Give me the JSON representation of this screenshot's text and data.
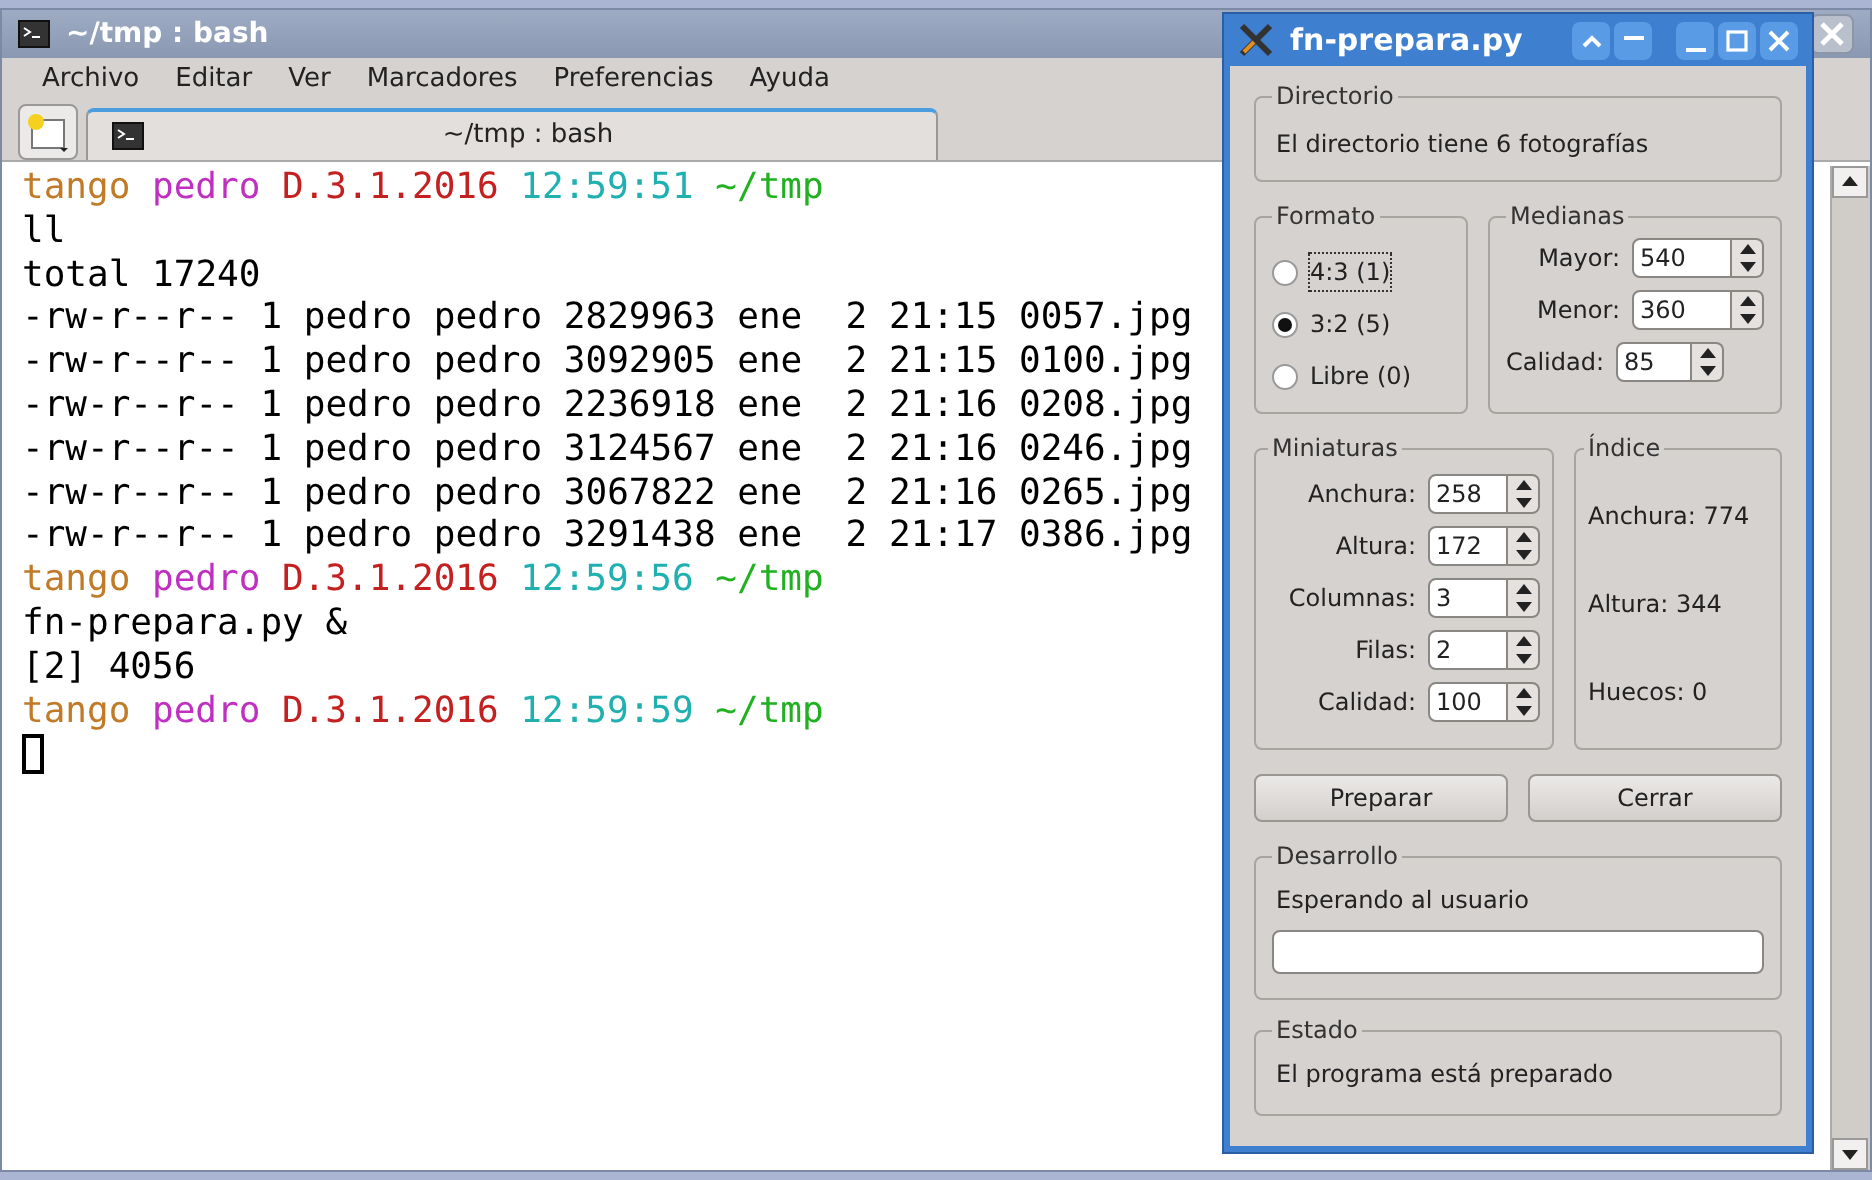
{
  "terminal": {
    "title": "~/tmp : bash",
    "menu": [
      "Archivo",
      "Editar",
      "Ver",
      "Marcadores",
      "Preferencias",
      "Ayuda"
    ],
    "tab": {
      "label": "~/tmp : bash",
      "selected": true
    },
    "lines": [
      {
        "kind": "prompt",
        "segments": [
          {
            "text": "tango",
            "color": "#c07a28"
          },
          {
            "text": "pedro",
            "color": "#c030c0"
          },
          {
            "text": "D.3.1.2016",
            "color": "#c42020"
          },
          {
            "text": "12:59:51",
            "color": "#20b0b0"
          },
          {
            "text": "~/tmp",
            "color": "#20b020"
          }
        ]
      },
      {
        "kind": "output",
        "text": "ll"
      },
      {
        "kind": "output",
        "text": "total 17240"
      },
      {
        "kind": "output",
        "text": "-rw-r--r-- 1 pedro pedro 2829963 ene  2 21:15 0057.jpg"
      },
      {
        "kind": "output",
        "text": "-rw-r--r-- 1 pedro pedro 3092905 ene  2 21:15 0100.jpg"
      },
      {
        "kind": "output",
        "text": "-rw-r--r-- 1 pedro pedro 2236918 ene  2 21:16 0208.jpg"
      },
      {
        "kind": "output",
        "text": "-rw-r--r-- 1 pedro pedro 3124567 ene  2 21:16 0246.jpg"
      },
      {
        "kind": "output",
        "text": "-rw-r--r-- 1 pedro pedro 3067822 ene  2 21:16 0265.jpg"
      },
      {
        "kind": "output",
        "text": "-rw-r--r-- 1 pedro pedro 3291438 ene  2 21:17 0386.jpg"
      },
      {
        "kind": "prompt",
        "segments": [
          {
            "text": "tango",
            "color": "#c07a28"
          },
          {
            "text": "pedro",
            "color": "#c030c0"
          },
          {
            "text": "D.3.1.2016",
            "color": "#c42020"
          },
          {
            "text": "12:59:56",
            "color": "#20b0b0"
          },
          {
            "text": "~/tmp",
            "color": "#20b020"
          }
        ]
      },
      {
        "kind": "output",
        "text": "fn-prepara.py &"
      },
      {
        "kind": "output",
        "text": "[2] 4056"
      },
      {
        "kind": "prompt",
        "segments": [
          {
            "text": "tango",
            "color": "#c07a28"
          },
          {
            "text": "pedro",
            "color": "#c030c0"
          },
          {
            "text": "D.3.1.2016",
            "color": "#c42020"
          },
          {
            "text": "12:59:59",
            "color": "#20b0b0"
          },
          {
            "text": "~/tmp",
            "color": "#20b020"
          }
        ]
      },
      {
        "kind": "cursor"
      }
    ]
  },
  "dialog": {
    "title": "fn-prepara.py",
    "directorio": {
      "title": "Directorio",
      "text": "El directorio tiene 6 fotografías"
    },
    "formato": {
      "title": "Formato",
      "options": [
        {
          "label": "4:3 (1)",
          "selected": false,
          "focused": true
        },
        {
          "label": "3:2 (5)",
          "selected": true,
          "focused": false
        },
        {
          "label": "Libre (0)",
          "selected": false,
          "focused": false
        }
      ]
    },
    "medianas": {
      "title": "Medianas",
      "fields": [
        {
          "label": "Mayor:",
          "value": "540"
        },
        {
          "label": "Menor:",
          "value": "360"
        },
        {
          "label": "Calidad:",
          "value": "85"
        }
      ]
    },
    "miniaturas": {
      "title": "Miniaturas",
      "fields": [
        {
          "label": "Anchura:",
          "value": "258"
        },
        {
          "label": "Altura:",
          "value": "172"
        },
        {
          "label": "Columnas:",
          "value": "3"
        },
        {
          "label": "Filas:",
          "value": "2"
        },
        {
          "label": "Calidad:",
          "value": "100"
        }
      ]
    },
    "indice": {
      "title": "Índice",
      "items": [
        "Anchura: 774",
        "Altura: 344",
        "Huecos: 0"
      ]
    },
    "buttons": [
      "Preparar",
      "Cerrar"
    ],
    "desarrollo": {
      "title": "Desarrollo",
      "text": "Esperando al usuario"
    },
    "estado": {
      "title": "Estado",
      "text": "El programa está preparado"
    }
  }
}
